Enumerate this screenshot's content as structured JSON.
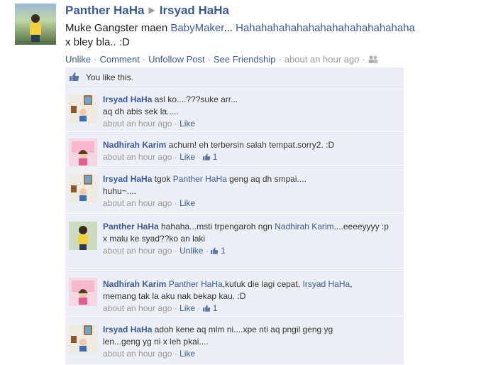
{
  "post": {
    "author": "Panther HaHa",
    "target": "Irsyad HaHa",
    "message_prefix": "Muke Gangster maen ",
    "message_link": "BabyMaker",
    "message_ellipsis": "...",
    "message_link2": " Hahahahahahahahahahahahahahaha",
    "message_line2": "x bley bla.. :D",
    "actions": {
      "unlike": "Unlike",
      "comment": "Comment",
      "unfollow": "Unfollow Post",
      "friendship": "See Friendship",
      "time": "about an hour ago"
    }
  },
  "likes": {
    "text": "You like this."
  },
  "comments": [
    {
      "name": "Irsyad HaHa",
      "text": "asl ko....???suke arr...",
      "line2": "aq dh abis sek la.....",
      "time": "about an hour ago",
      "action": "Like",
      "likes": ""
    },
    {
      "name": "Nadhirah Karim",
      "text": "achum! eh terbersin salah tempat.sorry2. :D",
      "time": "about an hour ago",
      "action": "Like",
      "likes": "1"
    },
    {
      "name": "Irsyad HaHa",
      "text_pre": "tgok ",
      "mention": "Panther HaHa",
      "text_post": " geng aq dh smpai....",
      "line2": "huhu~....",
      "time": "about an hour ago",
      "action": "Like"
    },
    {
      "name": "Panther HaHa",
      "text_pre": "hahaha...msti trpengaroh ngn ",
      "mention": "Nadhirah Karim",
      "text_post": "....eeeeyyyy :p",
      "line2": "x malu ke syad??ko an laki",
      "time": "about an hour ago",
      "action": "Unlike",
      "likes": "1"
    },
    {
      "name": "Nadhirah Karim",
      "mention": "Panther HaHa",
      "text_mid": ",kutuk die lagi cepat, ",
      "mention2": "Irsyad HaHa",
      "text_post": ",",
      "line2": "memang tak la aku nak bekap kau. :D",
      "time": "about an hour ago",
      "action": "Like",
      "likes": "1"
    },
    {
      "name": "Irsyad HaHa",
      "text": "adoh kene aq mlm ni....xpe nti aq pngil geng yg",
      "line2": "len...geng yg ni x leh pkai....",
      "time": "about an hour ago",
      "action": "Like"
    }
  ],
  "colors": {
    "link": "#3b5998",
    "box_bg": "#eceff5",
    "muted": "#999999"
  }
}
